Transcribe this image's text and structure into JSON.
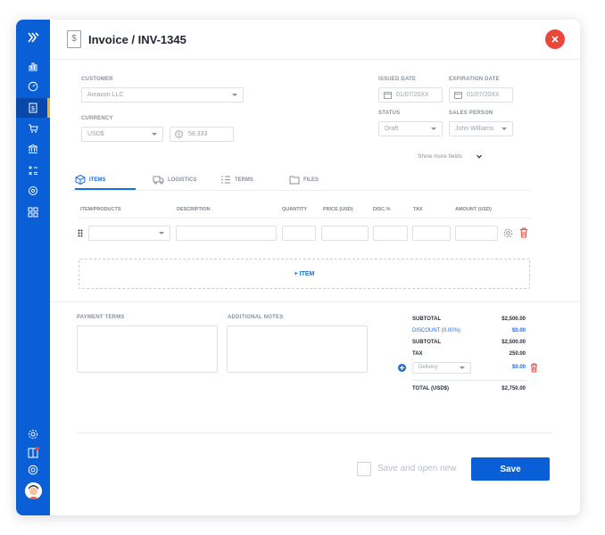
{
  "header": {
    "title": "Invoice / INV-1345",
    "doc_icon": "dollar-document-icon"
  },
  "form": {
    "customer_label": "CUSTOMER",
    "customer_value": "Amazon LLC",
    "currency_label": "CURRENCY",
    "currency_value": "USD$",
    "rate_value": "58,333",
    "issued_label": "ISSUED DATE",
    "issued_value": "01/07/20XX",
    "expiration_label": "EXPIRATION DATE",
    "expiration_value": "01/07/20XX",
    "status_label": "STATUS",
    "status_value": "Draft",
    "salesperson_label": "SALES PERSON",
    "salesperson_value": "John Williams",
    "show_more": "Show more fields"
  },
  "tabs": [
    {
      "label": "ITEMS",
      "icon": "box-icon"
    },
    {
      "label": "LOGISTICS",
      "icon": "truck-icon"
    },
    {
      "label": "TERMS",
      "icon": "list-icon"
    },
    {
      "label": "FILES",
      "icon": "folder-icon"
    }
  ],
  "columns": [
    "ITEM/PRODUCTS",
    "DESCRIPTION",
    "QUANTITY",
    "PRICE (USD)",
    "DISC.%",
    "TAX",
    "AMOUNT (USD)"
  ],
  "add_item_label": "+ ITEM",
  "notes": {
    "payment_terms_label": "PAYMENT TERMS",
    "additional_notes_label": "ADDITIONAL NOTES"
  },
  "totals": {
    "subtotal_label": "SUBTOTAL",
    "subtotal_value": "$2,500.00",
    "discount_label": "DISCOUNT (0.00%)",
    "discount_value": "$0.00",
    "subtotal2_label": "SUBTOTAL",
    "subtotal2_value": "$2,500.00",
    "tax_label": "TAX",
    "tax_value": "250.00",
    "delivery_placeholder": "Delivery",
    "delivery_value": "$0.00",
    "total_label": "TOTAL (USD$)",
    "total_value": "$2,750.00"
  },
  "footer": {
    "checkbox_label": "Save and open new",
    "save_label": "Save"
  },
  "colors": {
    "primary": "#0b5fd6",
    "danger": "#e9473b",
    "accent": "#f3b21b"
  }
}
